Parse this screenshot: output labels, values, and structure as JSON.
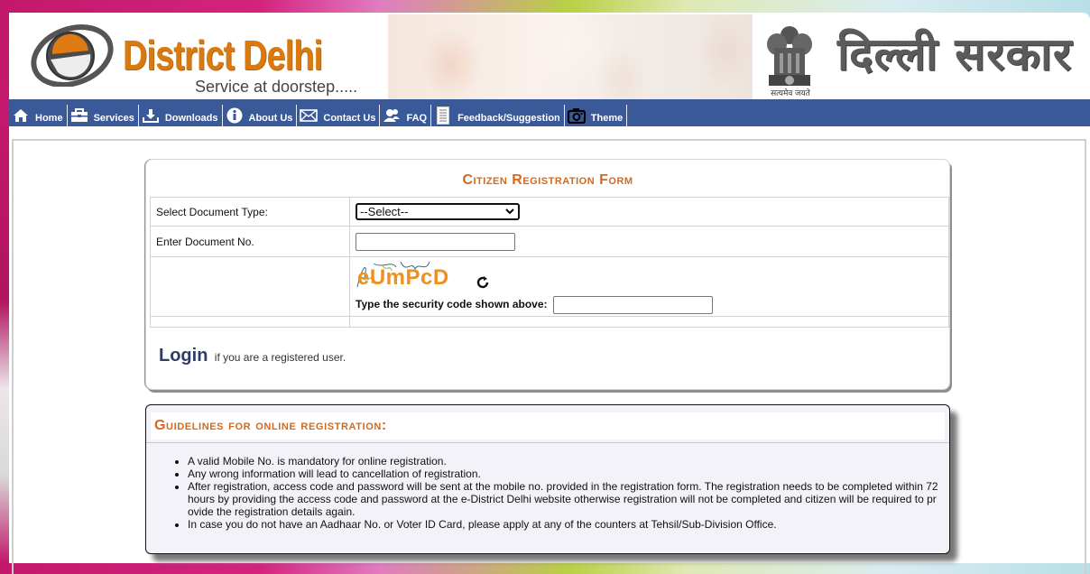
{
  "header": {
    "logo_title": "District Delhi",
    "logo_tagline": "Service at doorstep.....",
    "emblem_motto": "सत्यमेव जयते",
    "gov_title": "दिल्ली सरकार"
  },
  "nav": {
    "items": [
      {
        "label": "Home",
        "icon": "home-icon"
      },
      {
        "label": "Services",
        "icon": "briefcase-icon"
      },
      {
        "label": "Downloads",
        "icon": "download-icon"
      },
      {
        "label": "About Us",
        "icon": "info-icon"
      },
      {
        "label": "Contact Us",
        "icon": "envelope-icon"
      },
      {
        "label": "FAQ",
        "icon": "users-icon"
      },
      {
        "label": "Feedback/Suggestion",
        "icon": "document-icon"
      },
      {
        "label": "Theme",
        "icon": "camera-icon"
      }
    ]
  },
  "form": {
    "title": "Citizen Registration Form",
    "doc_type_label": "Select Document Type:",
    "doc_type_selected": "--Select--",
    "doc_no_label": "Enter Document No.",
    "doc_no_value": "",
    "captcha_text": "eUmPcD",
    "security_label": "Type the security code shown above:",
    "security_value": "",
    "login_link": "Login",
    "login_suffix": "if you are a registered user."
  },
  "guidelines": {
    "title": "Guidelines for online registration:",
    "items": [
      "A valid Mobile No. is mandatory for online registration.",
      "Any wrong information will lead to cancellation of registration.",
      "After registration, access code and password will be sent at the mobile no. provided in the registration form. The registration needs to be completed within 72 hours by providing the access code and password at the e-District Delhi website otherwise registration will not be completed and citizen will be required to pr ovide the registration details again.",
      "In case you do not have an Aadhaar No. or Voter ID Card, please apply at any of the counters at Tehsil/Sub-Division Office."
    ]
  },
  "colors": {
    "nav_bg": "#3a5998",
    "accent_orange": "#d2691e",
    "logo_orange": "#d97a10",
    "login_blue": "#2c3e66"
  }
}
